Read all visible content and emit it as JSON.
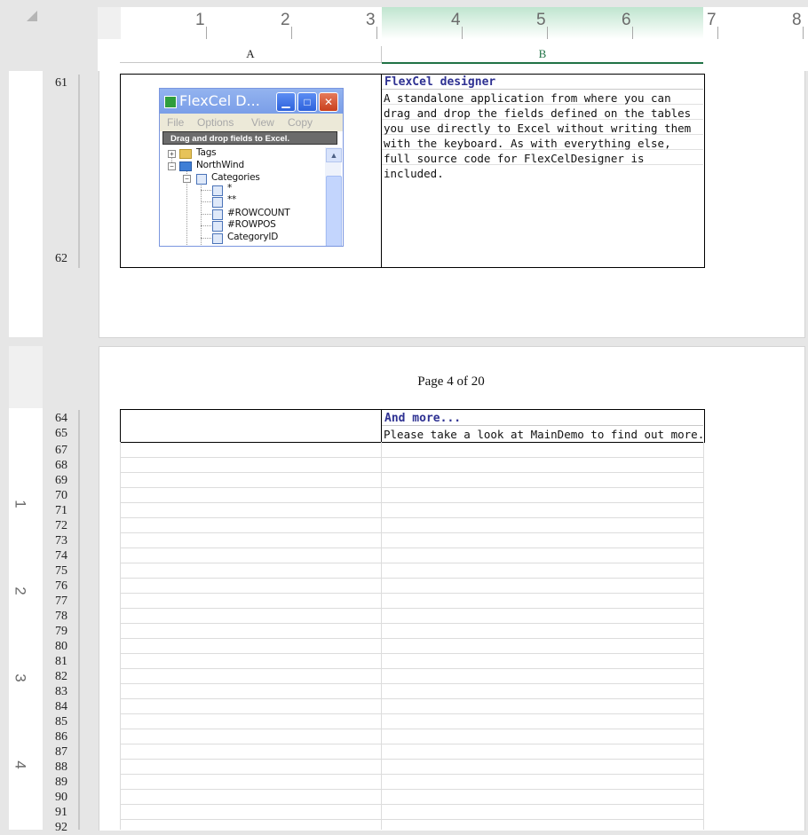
{
  "ruler": {
    "top_numbers": [
      "1",
      "2",
      "3",
      "4",
      "5",
      "6",
      "7",
      "8"
    ],
    "left_numbers": [
      "1",
      "2",
      "3",
      "4"
    ]
  },
  "columns": [
    "A",
    "B"
  ],
  "rows_page1": [
    "61",
    "62"
  ],
  "rows_page2": [
    "64",
    "65",
    "67",
    "68",
    "69",
    "70",
    "71",
    "72",
    "73",
    "74",
    "75",
    "76",
    "77",
    "78",
    "79",
    "80",
    "81",
    "82",
    "83",
    "84",
    "85",
    "86",
    "87",
    "88",
    "89",
    "90",
    "91",
    "92"
  ],
  "designer": {
    "title": "FlexCel designer",
    "description": "A standalone application from where you can drag and drop the fields defined on the tables you use directly to Excel without writing them with the keyboard. As with everything else, full source code for FlexCelDesigner is included.",
    "window": {
      "title": "FlexCel D...",
      "menu": [
        "File",
        "Options",
        "View",
        "Copy"
      ],
      "drag_hint": "Drag and drop fields to Excel.",
      "tree": [
        "Tags",
        "NorthWind",
        "Categories",
        "*",
        "**",
        "#ROWCOUNT",
        "#ROWPOS",
        "CategoryID"
      ]
    }
  },
  "page_label": "Page 4 of 20",
  "more": {
    "title": "And more...",
    "description": "Please take a look at MainDemo to find out more."
  },
  "colors": {
    "selected_column": "#217346",
    "title_text": "#2e3192"
  }
}
